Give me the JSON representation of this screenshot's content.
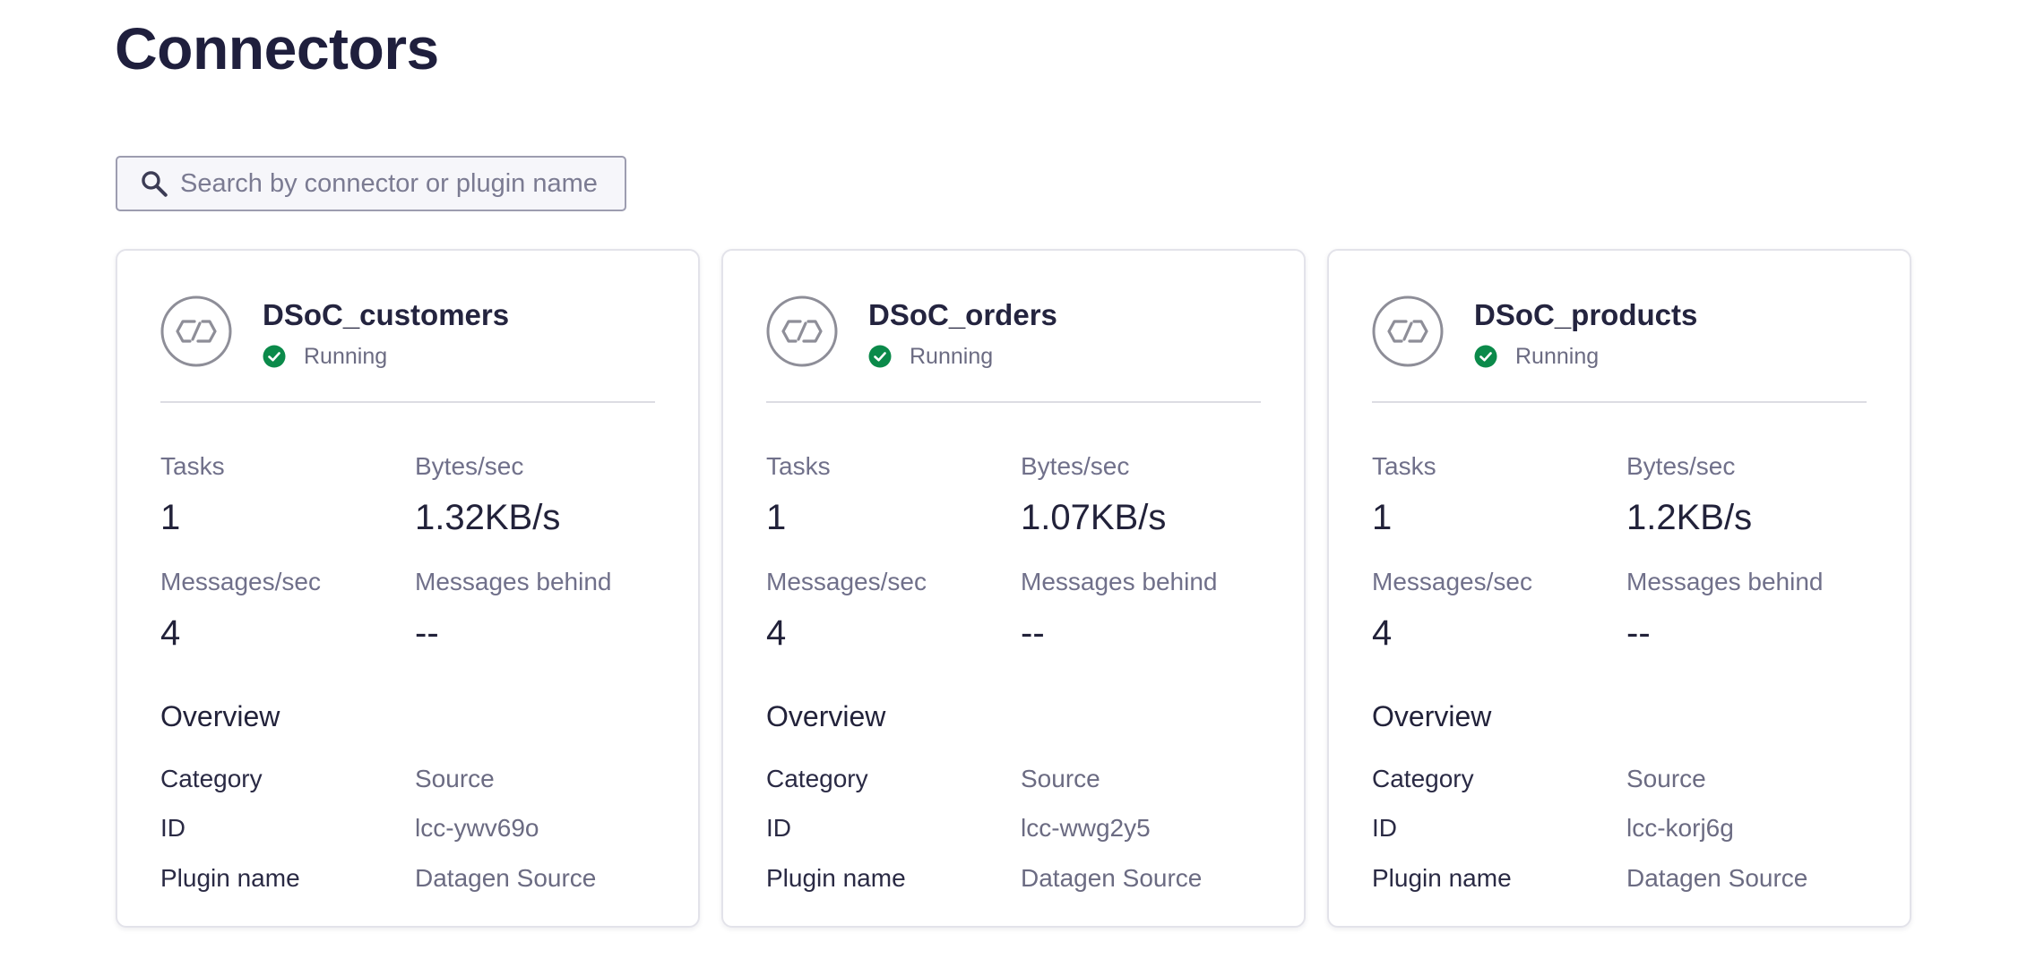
{
  "page": {
    "title": "Connectors"
  },
  "search": {
    "placeholder": "Search by connector or plugin name",
    "value": ""
  },
  "colors": {
    "title": "#1f1f3d",
    "status_running": "#0b8a4a",
    "icon_gray": "#8e8e98",
    "muted_text": "#70708a"
  },
  "labels": {
    "tasks": "Tasks",
    "bytes_per_sec": "Bytes/sec",
    "messages_per_sec": "Messages/sec",
    "messages_behind": "Messages behind",
    "overview": "Overview",
    "category": "Category",
    "id": "ID",
    "plugin_name": "Plugin name"
  },
  "connectors": [
    {
      "name": "DSoC_customers",
      "icon": "connector-link-icon",
      "status": "Running",
      "status_icon": "check-circle-icon",
      "tasks": "1",
      "bytes_per_sec": "1.32KB/s",
      "messages_per_sec": "4",
      "messages_behind": "--",
      "category": "Source",
      "id": "lcc-ywv69o",
      "plugin_name": "Datagen Source"
    },
    {
      "name": "DSoC_orders",
      "icon": "connector-link-icon",
      "status": "Running",
      "status_icon": "check-circle-icon",
      "tasks": "1",
      "bytes_per_sec": "1.07KB/s",
      "messages_per_sec": "4",
      "messages_behind": "--",
      "category": "Source",
      "id": "lcc-wwg2y5",
      "plugin_name": "Datagen Source"
    },
    {
      "name": "DSoC_products",
      "icon": "connector-link-icon",
      "status": "Running",
      "status_icon": "check-circle-icon",
      "tasks": "1",
      "bytes_per_sec": "1.2KB/s",
      "messages_per_sec": "4",
      "messages_behind": "--",
      "category": "Source",
      "id": "lcc-korj6g",
      "plugin_name": "Datagen Source"
    }
  ]
}
